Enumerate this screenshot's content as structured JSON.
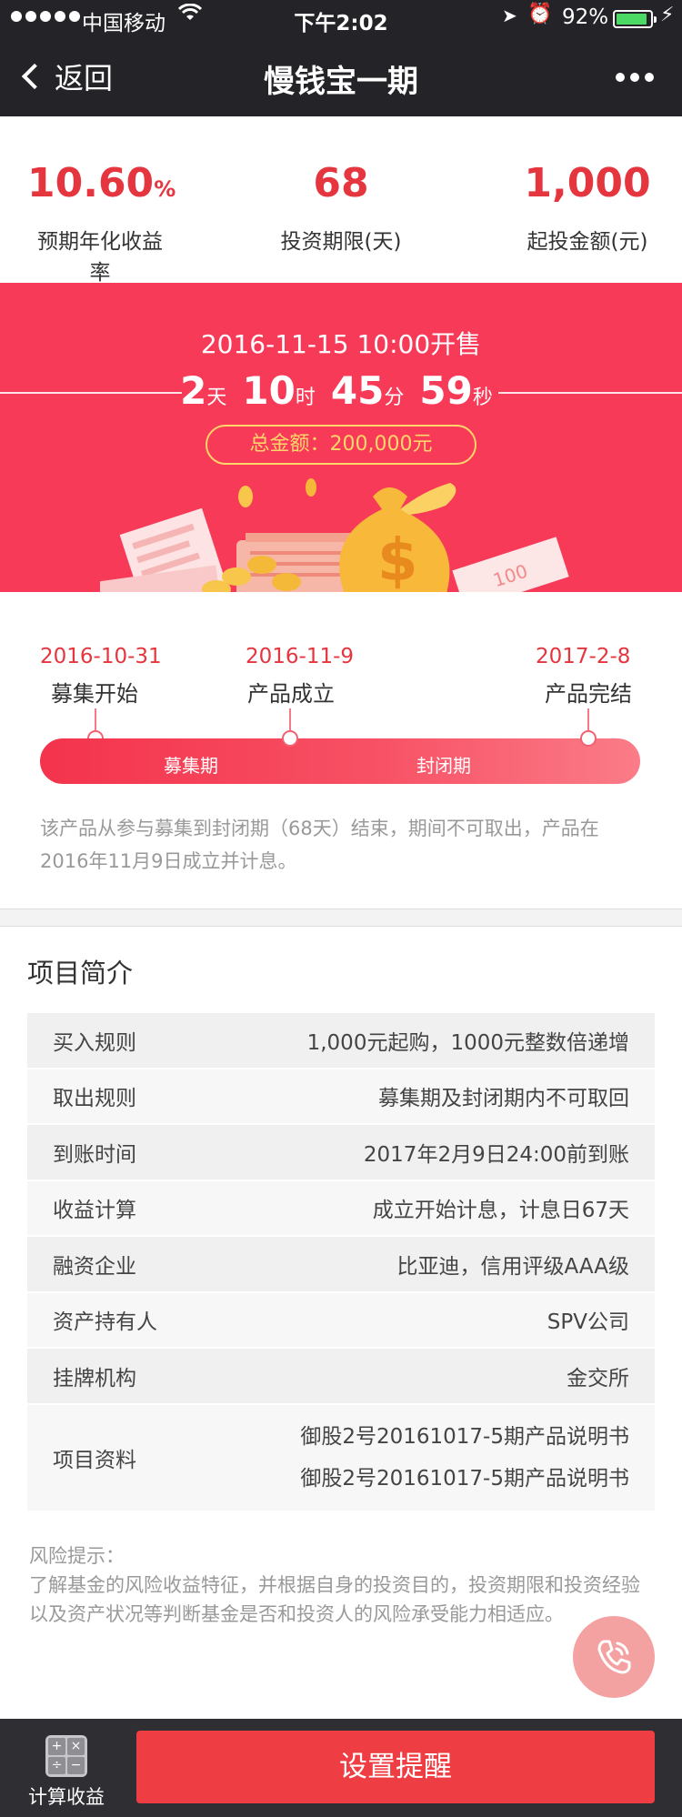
{
  "status_bar": {
    "carrier": "中国移动",
    "time": "下午2:02",
    "battery": "92%",
    "battery_level": 0.92
  },
  "nav": {
    "back_label": "返回",
    "title": "慢钱宝一期"
  },
  "stats": [
    {
      "value": "10.60",
      "unit": "%",
      "label": "预期年化收益率"
    },
    {
      "value": "68",
      "unit": "",
      "label": "投资期限(天)"
    },
    {
      "value": "1,000",
      "unit": "",
      "label": "起投金额(元)"
    }
  ],
  "banner": {
    "sale_time": "2016-11-15 10:00开售",
    "countdown": {
      "days": "2",
      "days_unit": "天",
      "hours": "10",
      "hours_unit": "时",
      "minutes": "45",
      "minutes_unit": "分",
      "seconds": "59",
      "seconds_unit": "秒"
    },
    "total": "总金额：200,000元"
  },
  "timeline": {
    "points": [
      {
        "date": "2016-10-31",
        "label": "募集开始"
      },
      {
        "date": "2016-11-9",
        "label": "产品成立"
      },
      {
        "date": "2017-2-8",
        "label": "产品完结"
      }
    ],
    "phases": [
      "募集期",
      "封闭期"
    ],
    "note": "该产品从参与募集到封闭期（68天）结束，期间不可取出，产品在2016年11月9日成立并计息。"
  },
  "intro": {
    "title": "项目简介",
    "rows": [
      {
        "key": "买入规则",
        "value": "1,000元起购，1000元整数倍递增"
      },
      {
        "key": "取出规则",
        "value": "募集期及封闭期内不可取回"
      },
      {
        "key": "到账时间",
        "value": "2017年2月9日24:00前到账"
      },
      {
        "key": "收益计算",
        "value": "成立开始计息，计息日67天"
      },
      {
        "key": "融资企业",
        "value": "比亚迪，信用评级AAA级"
      },
      {
        "key": "资产持有人",
        "value": "SPV公司"
      },
      {
        "key": "挂牌机构",
        "value": "金交所"
      },
      {
        "key": "项目资料",
        "values": [
          "御股2号20161017-5期产品说明书",
          "御股2号20161017-5期产品说明书"
        ]
      }
    ],
    "risk_title": "风险提示：",
    "risk_text": "了解基金的风险收益特征，并根据自身的投资目的，投资期限和投资经验以及资产状况等判断基金是否和投资人的风险承受能力相适应。"
  },
  "bottom": {
    "calc_label": "计算收益",
    "remind_label": "设置提醒"
  },
  "colors": {
    "accent": "#e5353f",
    "banner": "#f73a58",
    "gold": "#ffd66a",
    "nav_bg": "#232328",
    "bottom_bg": "#2e2e33",
    "button": "#ef3e43"
  }
}
